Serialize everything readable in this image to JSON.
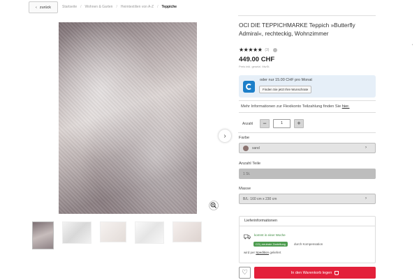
{
  "nav": {
    "back_label": "zurück",
    "breadcrumb": [
      "Startseite",
      "Wohnen & Garten",
      "Heimtextilien von A-Z",
      "Teppiche"
    ]
  },
  "product": {
    "title": "OCI DIE TEPPICHMARKE Teppich »Butterfly Admiral«, rechteckig, Wohnzimmer",
    "rating_stars": 5,
    "rating_count": "(3)",
    "price": "449.00 CHF",
    "price_note": "Preis inkl. gesetzl. MwSt."
  },
  "financing": {
    "text": "oder nur 15.00 CHF pro Monat",
    "button_label": "Finden Sie jetzt Ihre Wunschrate",
    "flexi_text": "Mehr Informationen zur Flexikonto Teilzahlung finden Sie",
    "flexi_link": "hier."
  },
  "quantity": {
    "label": "Anzahl",
    "value": "1",
    "minus": "−",
    "plus": "+"
  },
  "options": {
    "color_label": "Farbe",
    "color_value": "sand",
    "color_swatch": "#8b7370",
    "parts_label": "Anzahl Teile",
    "parts_value": "1 St.",
    "size_label": "Masse",
    "size_value": "B/L: 160 cm x 230 cm",
    "chevron": "›"
  },
  "delivery": {
    "title": "Lieferinformationen",
    "time": "kommt in einer Woche",
    "co2_badge": "CO₂-neutrale Zustellung",
    "co2_text": "durch Kompensation",
    "shipping_prefix": "wird per",
    "shipping_link": "Spedition",
    "shipping_suffix": "geliefert"
  },
  "actions": {
    "cart_label": "In den Warenkorb legen",
    "wishlist_icon": "heart-icon",
    "next_icon": "chevron-right-icon"
  },
  "colors": {
    "accent": "#e3203a",
    "finance_bg": "#e6eff8",
    "finance_logo": "#1c7fc9",
    "green": "#4d9c4f"
  }
}
